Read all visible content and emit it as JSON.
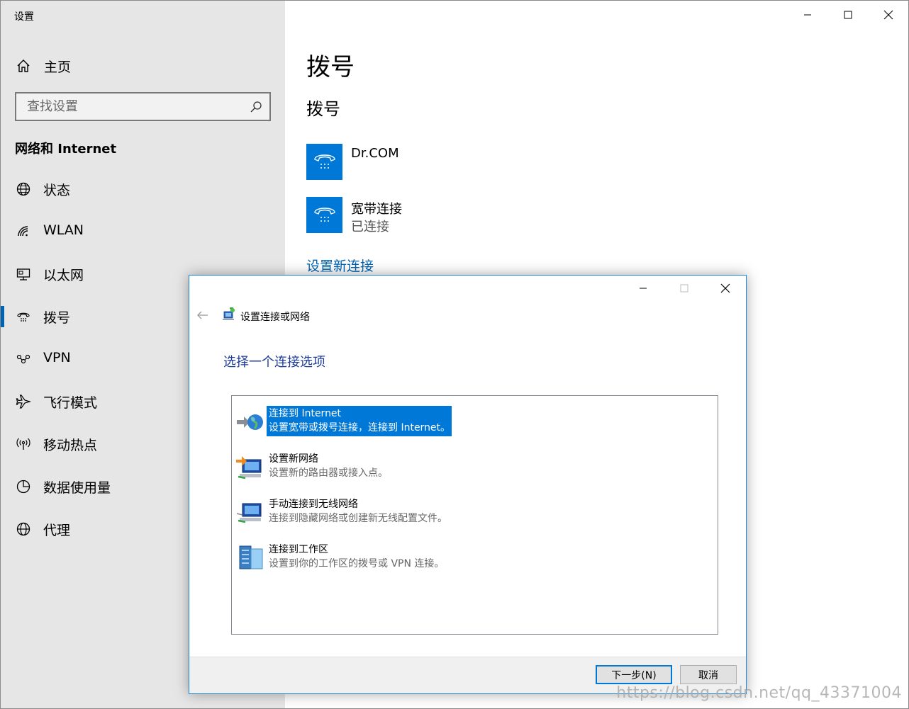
{
  "window": {
    "title": "设置"
  },
  "sidebar": {
    "home_label": "主页",
    "search_placeholder": "查找设置",
    "section_title": "网络和 Internet",
    "items": [
      {
        "label": "状态",
        "icon": "globe-status-icon"
      },
      {
        "label": "WLAN",
        "icon": "wifi-icon"
      },
      {
        "label": "以太网",
        "icon": "ethernet-icon"
      },
      {
        "label": "拨号",
        "icon": "dialup-icon",
        "active": true
      },
      {
        "label": "VPN",
        "icon": "vpn-icon"
      },
      {
        "label": "飞行模式",
        "icon": "airplane-icon"
      },
      {
        "label": "移动热点",
        "icon": "hotspot-icon"
      },
      {
        "label": "数据使用量",
        "icon": "data-usage-icon"
      },
      {
        "label": "代理",
        "icon": "proxy-globe-icon"
      }
    ]
  },
  "main": {
    "page_title": "拨号",
    "section_title": "拨号",
    "connections": [
      {
        "name": "Dr.COM",
        "status": ""
      },
      {
        "name": "宽带连接",
        "status": "已连接"
      }
    ],
    "setup_link": "设置新连接"
  },
  "dialog": {
    "title": "设置连接或网络",
    "heading": "选择一个连接选项",
    "options": [
      {
        "title": "连接到 Internet",
        "desc": "设置宽带或拨号连接，连接到 Internet。",
        "icon": "internet-globe-icon",
        "selected": true
      },
      {
        "title": "设置新网络",
        "desc": "设置新的路由器或接入点。",
        "icon": "new-network-icon"
      },
      {
        "title": "手动连接到无线网络",
        "desc": "连接到隐藏网络或创建新无线配置文件。",
        "icon": "wireless-network-icon"
      },
      {
        "title": "连接到工作区",
        "desc": "设置到你的工作区的拨号或 VPN 连接。",
        "icon": "workplace-icon"
      }
    ],
    "next_button": "下一步(N)",
    "cancel_button": "取消"
  },
  "watermark": "https://blog.csdn.net/qq_43371004",
  "colors": {
    "accent": "#0078d7",
    "link": "#0063b1",
    "sidebar_bg": "#e6e6e6",
    "dialog_heading": "#1f3c99"
  }
}
